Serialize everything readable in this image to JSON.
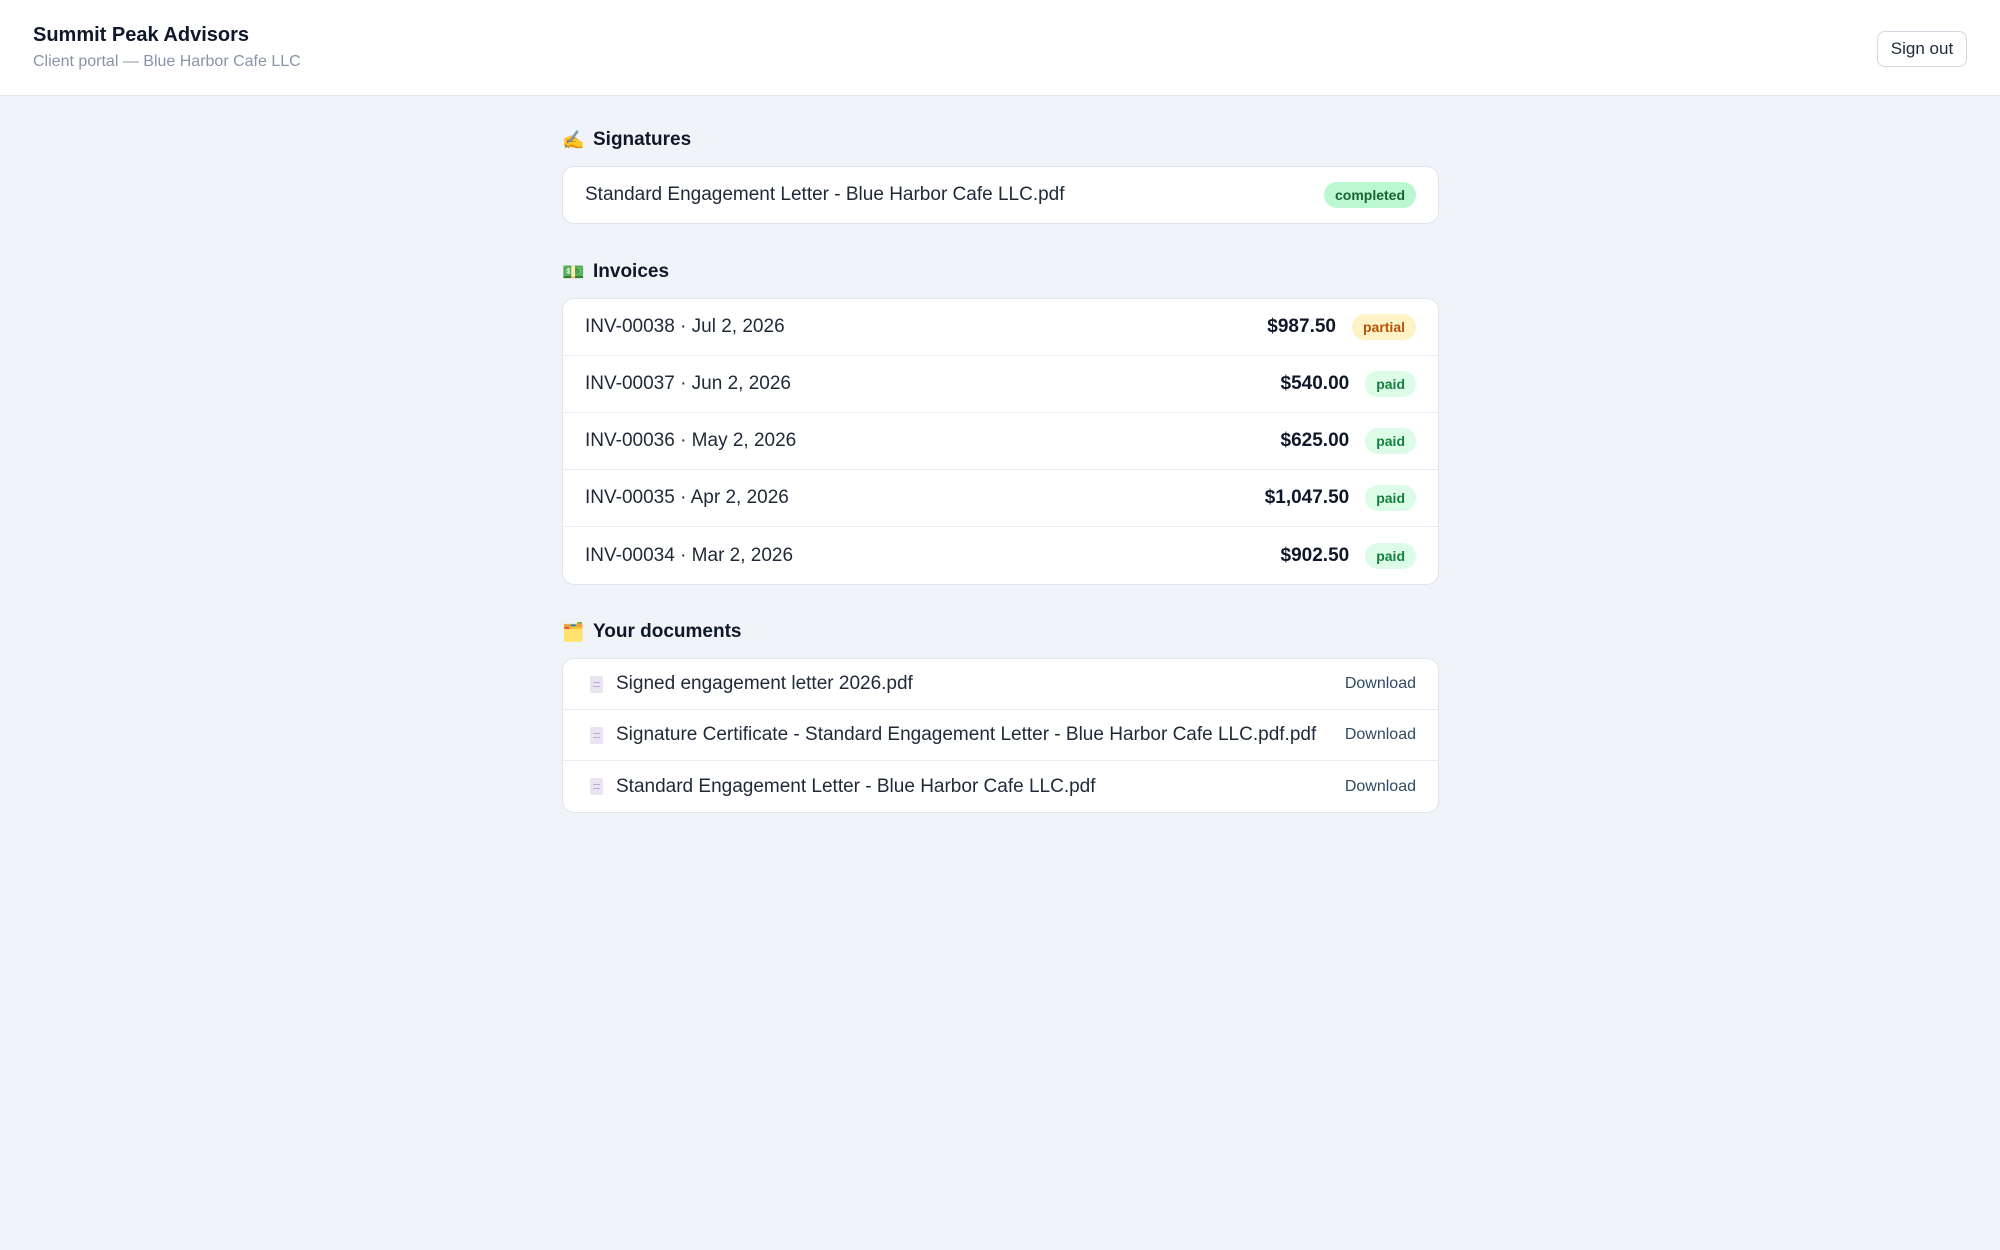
{
  "header": {
    "firm_name": "Summit Peak Advisors",
    "subtitle": "Client portal — Blue Harbor Cafe LLC",
    "signout_label": "Sign out"
  },
  "signatures": {
    "icon": "✍️",
    "title": "Signatures",
    "items": [
      {
        "name": "Standard Engagement Letter - Blue Harbor Cafe LLC.pdf",
        "status": "completed"
      }
    ]
  },
  "invoices": {
    "icon": "💵",
    "title": "Invoices",
    "items": [
      {
        "label": "INV-00038 · Jul 2, 2026",
        "amount": "$987.50",
        "status": "partial"
      },
      {
        "label": "INV-00037 · Jun 2, 2026",
        "amount": "$540.00",
        "status": "paid"
      },
      {
        "label": "INV-00036 · May 2, 2026",
        "amount": "$625.00",
        "status": "paid"
      },
      {
        "label": "INV-00035 · Apr 2, 2026",
        "amount": "$1,047.50",
        "status": "paid"
      },
      {
        "label": "INV-00034 · Mar 2, 2026",
        "amount": "$902.50",
        "status": "paid"
      }
    ]
  },
  "documents": {
    "icon": "🗂️",
    "title": "Your documents",
    "download_label": "Download",
    "items": [
      {
        "name": "Signed engagement letter 2026.pdf"
      },
      {
        "name": "Signature Certificate - Standard Engagement Letter - Blue Harbor Cafe LLC.pdf.pdf"
      },
      {
        "name": "Standard Engagement Letter - Blue Harbor Cafe LLC.pdf"
      }
    ]
  },
  "colors": {
    "page_background": "#f0f3f8",
    "paid_badge": "#dcfce7",
    "partial_badge": "#fef3c7",
    "completed_badge": "#bbf7d0"
  }
}
